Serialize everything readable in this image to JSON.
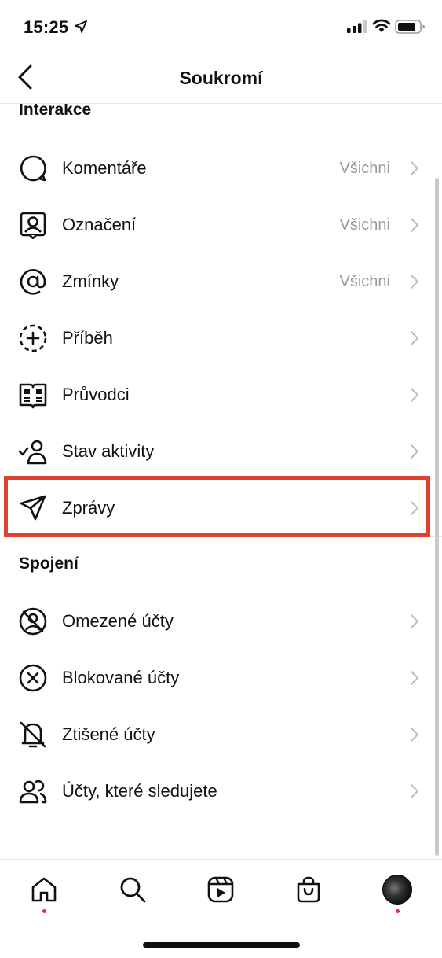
{
  "status_bar": {
    "time": "15:25"
  },
  "header": {
    "title": "Soukromí"
  },
  "sections": [
    {
      "title": "Interakce",
      "items": [
        {
          "label": "Komentáře",
          "value": "Všichni",
          "icon": "comment-icon"
        },
        {
          "label": "Označení",
          "value": "Všichni",
          "icon": "tag-person-icon"
        },
        {
          "label": "Zmínky",
          "value": "Všichni",
          "icon": "at-sign-icon"
        },
        {
          "label": "Příběh",
          "value": "",
          "icon": "story-plus-icon"
        },
        {
          "label": "Průvodci",
          "value": "",
          "icon": "guide-icon"
        },
        {
          "label": "Stav aktivity",
          "value": "",
          "icon": "activity-status-icon"
        },
        {
          "label": "Zprávy",
          "value": "",
          "icon": "paper-plane-icon"
        }
      ]
    },
    {
      "title": "Spojení",
      "items": [
        {
          "label": "Omezené účty",
          "value": "",
          "icon": "restricted-icon"
        },
        {
          "label": "Blokované účty",
          "value": "",
          "icon": "blocked-icon"
        },
        {
          "label": "Ztišené účty",
          "value": "",
          "icon": "muted-bell-icon"
        },
        {
          "label": "Účty, které sledujete",
          "value": "",
          "icon": "people-icon"
        }
      ]
    }
  ],
  "tab_bar": [
    "home-icon",
    "search-icon",
    "reels-icon",
    "shop-icon",
    "profile-avatar"
  ],
  "colors": {
    "highlight": "#e0412f",
    "notification_dot": "#ee2452",
    "value_text": "#9a9a9a"
  }
}
